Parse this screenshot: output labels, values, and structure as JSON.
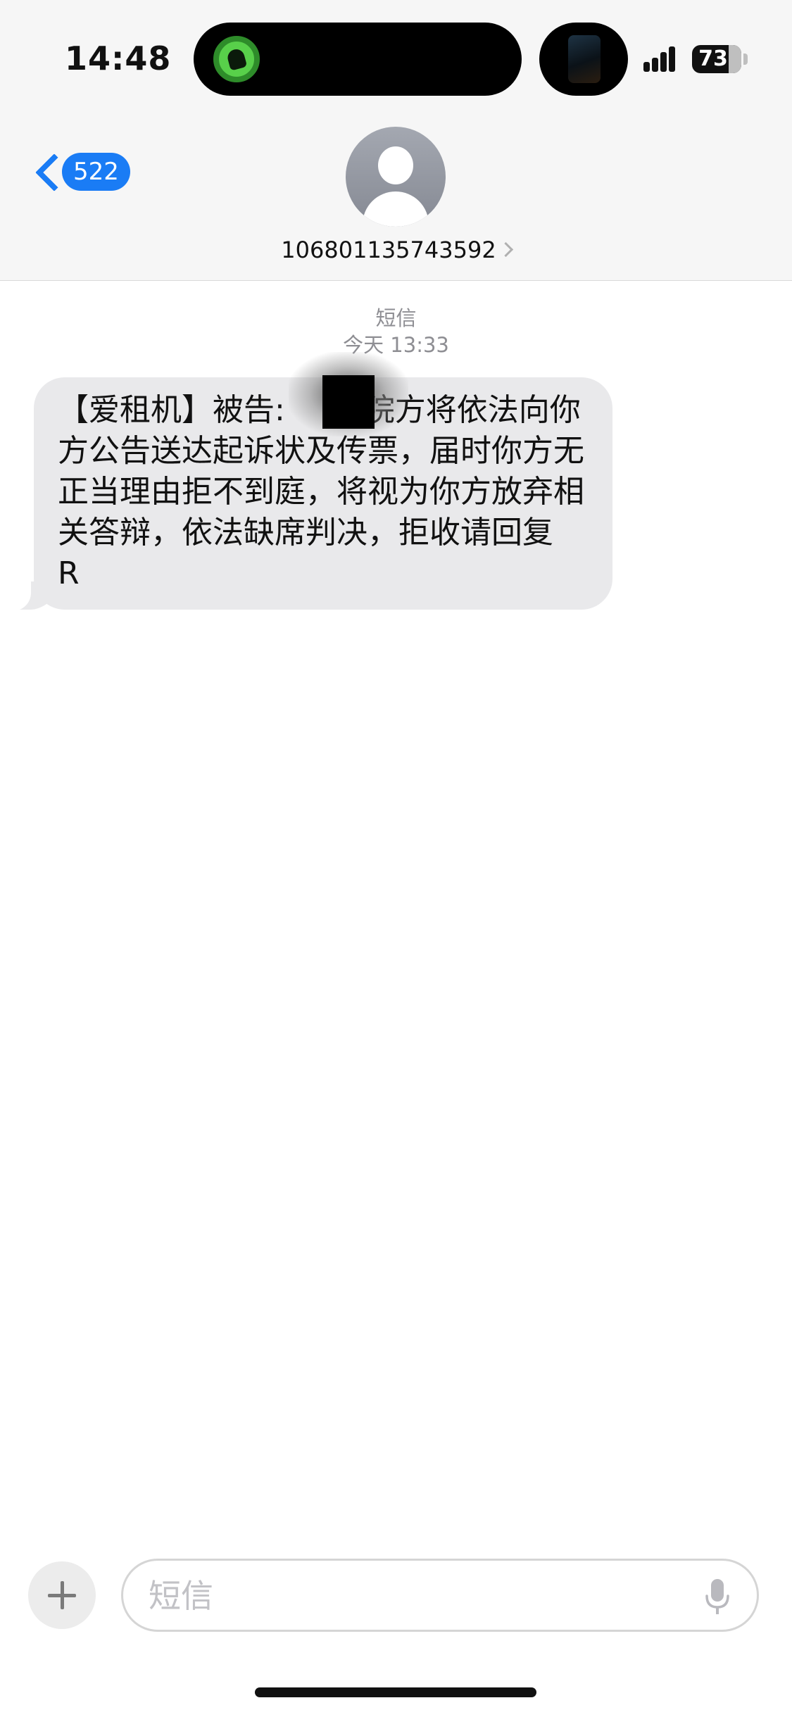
{
  "status_bar": {
    "time": "14:48",
    "battery": "73",
    "icons": [
      "activity-icon",
      "now-playing-thumbnail",
      "cellular-signal-icon",
      "battery-icon"
    ]
  },
  "nav": {
    "back_badge": "522",
    "contact_number": "106801135743592",
    "icons": [
      "chevron-left-icon",
      "contact-avatar-icon",
      "chevron-right-icon"
    ]
  },
  "conversation": {
    "service_label": "短信",
    "timestamp": "今天 13:33",
    "messages": [
      {
        "direction": "incoming",
        "text": "【爱租机】被告:        院方将依法向你方公告送达起诉状及传票，届时你方无正当理由拒不到庭，将视为你方放弃相关答辩，依法缺席判决，拒收请回复 R"
      }
    ]
  },
  "composer": {
    "placeholder": "短信",
    "icons": [
      "plus-icon",
      "microphone-icon"
    ]
  },
  "colors": {
    "accent": "#1a7cf5",
    "bubble_incoming": "#e9e9eb",
    "header_bg": "#f6f6f6",
    "meta_text": "#8e8e93"
  }
}
